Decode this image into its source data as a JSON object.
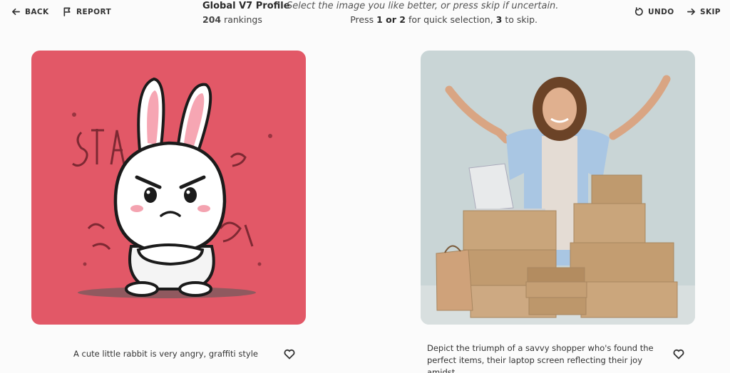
{
  "header": {
    "back_label": "BACK",
    "report_label": "REPORT",
    "undo_label": "UNDO",
    "skip_label": "SKIP",
    "title": "Global V7 Profile",
    "rankings_count": "204",
    "rankings_suffix": " rankings",
    "instruction": "Select the image you like better, or press skip if uncertain.",
    "shortcut_prefix": "Press ",
    "shortcut_keys": "1 or 2",
    "shortcut_mid": " for quick selection, ",
    "shortcut_skip_key": "3",
    "shortcut_suffix": " to skip."
  },
  "left": {
    "caption": "A cute little rabbit is very angry, graffiti style",
    "bg_color": "#e25867"
  },
  "right": {
    "caption": "Depict the triumph of a savvy shopper who's found the perfect items, their laptop screen reflecting their joy amidst…",
    "bg_color": "#c9d5d6"
  },
  "icons": {
    "back": "arrow-left-icon",
    "report": "flag-icon",
    "undo": "undo-icon",
    "skip": "arrow-right-icon",
    "favorite": "heart-icon"
  }
}
